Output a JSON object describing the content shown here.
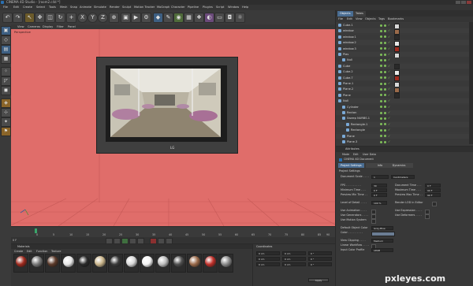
{
  "window": {
    "title": "CINEMA 4D Studio - [room2.c4d *]"
  },
  "menubar": [
    "File",
    "Edit",
    "Create",
    "Select",
    "Tools",
    "Mesh",
    "Snap",
    "Animate",
    "Simulate",
    "Render",
    "Sculpt",
    "Motion Tracker",
    "MoGraph",
    "Character",
    "Pipeline",
    "Plugins",
    "Script",
    "Window",
    "Help"
  ],
  "toolbar": {
    "icons": [
      "undo-icon",
      "redo-icon",
      "select-icon",
      "move-icon",
      "scale-icon",
      "rotate-icon",
      "add-icon",
      "x-axis-icon",
      "y-axis-icon",
      "z-axis-icon",
      "coordinate-icon",
      "render-region-icon",
      "render-view-icon",
      "render-settings-icon",
      "cube-icon",
      "pen-icon",
      "subdivision-icon",
      "array-icon",
      "cloner-icon",
      "deformer-icon",
      "floor-icon",
      "camera-icon",
      "light-icon"
    ],
    "axes": [
      "X",
      "Y",
      "Z"
    ]
  },
  "viewport": {
    "menu": [
      "View",
      "Cameras",
      "Display",
      "Filter",
      "Panel"
    ],
    "label": "Perspective",
    "tv_logo": "LG"
  },
  "timeline": {
    "ticks": [
      "0",
      "5",
      "10",
      "15",
      "20",
      "25",
      "30",
      "35",
      "40",
      "45",
      "50",
      "55",
      "60",
      "65",
      "70",
      "75",
      "80",
      "85",
      "90"
    ],
    "frame": "0 F"
  },
  "materials": {
    "menu": [
      "Create",
      "Edit",
      "Function",
      "Texture"
    ],
    "title": "Materials",
    "swatches": [
      {
        "color": "#a02a1e"
      },
      {
        "color": "#7a7a7a"
      },
      {
        "color": "#5c3a2a"
      },
      {
        "color": "#e8e8e8"
      },
      {
        "color": "#2a2a2a"
      },
      {
        "color": "#c9b48a"
      },
      {
        "color": "#3b3b3b"
      },
      {
        "color": "#d8d8d8"
      },
      {
        "color": "#f4f4f4"
      },
      {
        "color": "#bdbdbd"
      },
      {
        "color": "#505050"
      },
      {
        "color": "#9a6a4a"
      },
      {
        "color": "#c0302a"
      },
      {
        "color": "#8a8a8a"
      }
    ]
  },
  "coordinates": {
    "title": "Coordinates",
    "fields": [
      "0 cm",
      "0 cm",
      "0 cm",
      "0 cm",
      "0 cm",
      "0 cm",
      "0 °",
      "0 °",
      "0 °"
    ],
    "apply_label": "Apply"
  },
  "objects": {
    "tabs": [
      "Objects",
      "Takes"
    ],
    "menu": [
      "File",
      "Edit",
      "View",
      "Objects",
      "Tags",
      "Bookmarks"
    ],
    "rows": [
      {
        "name": "Cube.1",
        "indent": 0
      },
      {
        "name": "window",
        "indent": 0
      },
      {
        "name": "window.1",
        "indent": 0
      },
      {
        "name": "window.2",
        "indent": 0
      },
      {
        "name": "window.3",
        "indent": 0
      },
      {
        "name": "Plas",
        "indent": 0
      },
      {
        "name": "Null",
        "indent": 1
      },
      {
        "name": "Cube",
        "indent": 0
      },
      {
        "name": "Cube.2",
        "indent": 0
      },
      {
        "name": "Cube.7",
        "indent": 0
      },
      {
        "name": "Plane.1",
        "indent": 0
      },
      {
        "name": "Plane.2",
        "indent": 0
      },
      {
        "name": "Plane",
        "indent": 0
      },
      {
        "name": "Null",
        "indent": 0
      },
      {
        "name": "Cylinder",
        "indent": 1
      },
      {
        "name": "Rectan",
        "indent": 1
      },
      {
        "name": "Sweep NURBS.1",
        "indent": 1
      },
      {
        "name": "Rectangle.1",
        "indent": 2
      },
      {
        "name": "Rectangle",
        "indent": 2
      },
      {
        "name": "Plane",
        "indent": 1
      },
      {
        "name": "Plane.3",
        "indent": 1
      }
    ]
  },
  "attributes": {
    "title": "Attributes",
    "menu": [
      "Mode",
      "Edit",
      "User Data"
    ],
    "subtitle": "CINEMA 4D Document",
    "tabs": [
      "Project Settings",
      "Info",
      "Dynamics"
    ],
    "section": "Project Settings",
    "fields": {
      "document_scale_label": "Document Scale . . . .",
      "document_scale_value": "1",
      "document_scale_unit": "Centimeters",
      "fps_label": "FPS . . . . . . . . .",
      "fps_value": "30",
      "doc_time_label": "Document Time . . .",
      "doc_time_value": "0 F",
      "min_time_label": "Minimum Time . . .",
      "min_time_value": "0 F",
      "max_time_label": "Maximum Time . . .",
      "max_time_value": "90 F",
      "prev_min_label": "Preview Min Time . .",
      "prev_min_value": "0 F",
      "prev_max_label": "Preview Max Time . .",
      "prev_max_value": "90 F",
      "lod_label": "Level of Detail . . . .",
      "lod_value": "100 %",
      "render_lod_label": "Render LOD in Editor",
      "use_anim_label": "Use Animation . . . .",
      "use_expr_label": "Use Expression . . . .",
      "use_gen_label": "Use Generators . . . .",
      "use_deform_label": "Use Deformers . . . .",
      "use_motion_label": "Use Motion System",
      "obj_color_label": "Default Object Color",
      "obj_color_value": "Gray-Blue",
      "color_label": "Color . . . . . . . . .",
      "view_clip_label": "View Clipping . . . .",
      "view_clip_value": "Medium",
      "linear_wf_label": "Linear Workflow . . . .",
      "input_profile_label": "Input Color Profile",
      "input_profile_value": "sRGB"
    }
  },
  "watermark": "pxleyes.com"
}
